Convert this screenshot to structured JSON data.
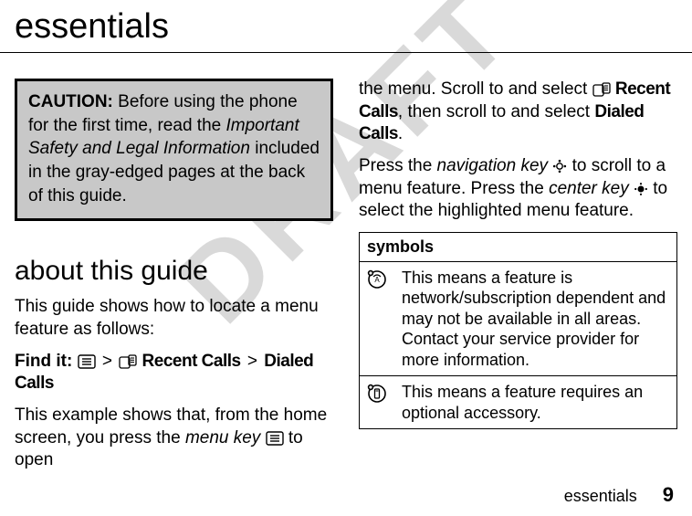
{
  "watermark": "DRAFT",
  "page_title": "essentials",
  "caution": {
    "label": "CAUTION:",
    "pre": " Before using the phone for the first time, read the ",
    "italic": "Important Safety and Legal Information",
    "post": " included in the gray-edged pages at the back of this guide."
  },
  "section_title": "about this guide",
  "intro": "This guide shows how to locate a menu feature as follows:",
  "findit": {
    "label": "Find it:",
    "sep": ">",
    "recent_calls": "Recent Calls",
    "dialed_calls": "Dialed Calls"
  },
  "example": {
    "pre": "This example shows that, from the home screen, you press the ",
    "menu_key": "menu key",
    "post": " to open"
  },
  "right": {
    "line1_pre": "the menu. Scroll to and select ",
    "recent_calls": "Recent Calls",
    "line1_mid": ", then scroll to and select ",
    "dialed_calls": "Dialed Calls",
    "line1_end": ".",
    "line2_pre": "Press the ",
    "nav_key": "navigation key",
    "line2_mid": " to scroll to a menu feature. Press the ",
    "center_key": "center key",
    "line2_end": " to select the highlighted menu feature."
  },
  "symbols": {
    "header": "symbols",
    "rows": [
      {
        "desc": "This means a feature is network/subscription dependent and may not be available in all areas. Contact your service provider for more information."
      },
      {
        "desc": "This means a feature requires an optional accessory."
      }
    ]
  },
  "footer": {
    "section": "essentials",
    "page": "9"
  }
}
